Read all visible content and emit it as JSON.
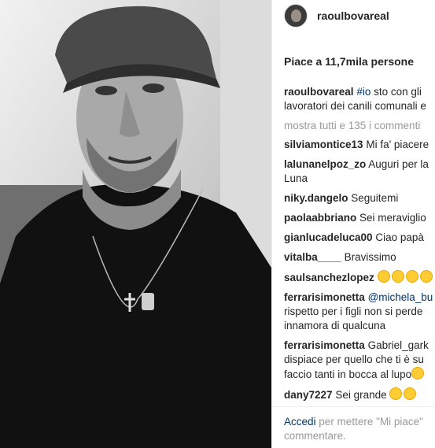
{
  "post": {
    "username": "raoulbovareal",
    "likes": "Piace a 11,7mila persone",
    "caption_user": "raoulbovareal",
    "caption_tag": "#io",
    "caption_text_1": "sto con gli",
    "caption_text_2": "lavoratori dei canili comunali e",
    "show_all": "mostra tutti e 135 i commenti"
  },
  "comments": [
    {
      "user": "silviamontice13",
      "lines": [
        "Mi fa' piacere"
      ]
    },
    {
      "user": "lalunanelpoz_zo",
      "lines": [
        "Auguri per la",
        "Luna"
      ]
    },
    {
      "user": "niky.dangelo",
      "lines": [
        "Seguitemi"
      ]
    },
    {
      "user": "paolaabbriano",
      "lines": [
        "Sei meraviglio"
      ]
    },
    {
      "user": "gianlucadeluca00",
      "lines": [
        "Ciao papà"
      ]
    },
    {
      "user": "vitalba____",
      "lines": [
        "Bravissimo"
      ]
    },
    {
      "user": "saulsanchezlopez",
      "lines": [
        ""
      ]
    },
    {
      "user": "ferrarisimonetta",
      "mention": "@michela_bu",
      "lines": [
        "rispetto per i figli non si perde",
        "innamora di qualcuna"
      ]
    },
    {
      "user": "ferrarisimonetta",
      "lines": [
        "Gabriel_gark",
        "dispiace per quello che ti è su",
        "faccio tanti in bocca al lupo"
      ]
    },
    {
      "user": "dany7227",
      "lines": [
        "Sei grande"
      ]
    }
  ],
  "footer": {
    "login": "Accedi",
    "text_1": "per mettere \"Mi piace\"",
    "text_2": "commentare."
  },
  "icons": [
    "avatar",
    "emoji-kiss-icon"
  ]
}
